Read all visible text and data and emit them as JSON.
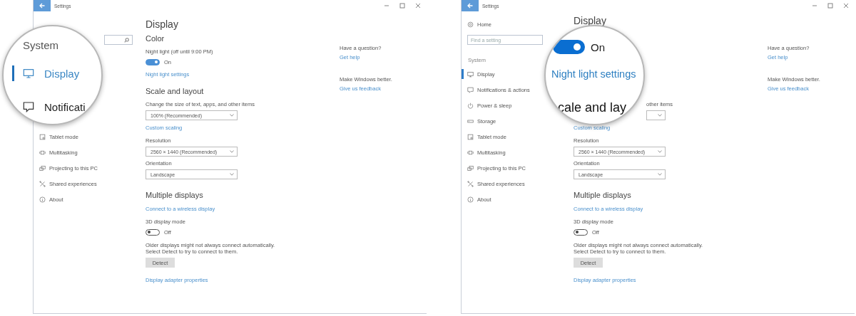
{
  "windows": [
    {
      "title": "Settings",
      "magnifier": {
        "kind": "sidebar",
        "blocks": [
          {
            "kind": "heading",
            "text": "System"
          },
          {
            "kind": "display",
            "text": "Display",
            "selected": true
          },
          {
            "kind": "notifications",
            "text": "Notificati",
            "selected": false
          }
        ]
      },
      "sidebar": {
        "search_icon": true,
        "items": [
          {
            "kind": "tablet",
            "label": "Tablet mode",
            "selected": false
          },
          {
            "kind": "multitasking",
            "label": "Multitasking",
            "selected": false
          },
          {
            "kind": "projecting",
            "label": "Projecting to this PC",
            "selected": false
          },
          {
            "kind": "shared",
            "label": "Shared experiences",
            "selected": false
          },
          {
            "kind": "about",
            "label": "About",
            "selected": false
          }
        ]
      },
      "content": [
        {
          "kind": "heading",
          "text": "Display"
        },
        {
          "kind": "section",
          "text": "Color"
        },
        {
          "kind": "label",
          "text": "Night light (off until 9:00 PM)"
        },
        {
          "kind": "toggle",
          "on": true,
          "text": "On"
        },
        {
          "kind": "link",
          "text": "Night light settings"
        },
        {
          "kind": "section",
          "text": "Scale and layout"
        },
        {
          "kind": "label",
          "text": "Change the size of text, apps, and other items"
        },
        {
          "kind": "dropdown",
          "value": "100% (Recommended)"
        },
        {
          "kind": "link",
          "text": "Custom scaling"
        },
        {
          "kind": "label",
          "text": "Resolution"
        },
        {
          "kind": "dropdown",
          "value": "2560 × 1440 (Recommended)"
        },
        {
          "kind": "label",
          "text": "Orientation"
        },
        {
          "kind": "dropdown",
          "value": "Landscape"
        },
        {
          "kind": "section",
          "text": "Multiple displays"
        },
        {
          "kind": "link",
          "text": "Connect to a wireless display"
        },
        {
          "kind": "label",
          "text": "3D display mode"
        },
        {
          "kind": "toggle",
          "on": false,
          "text": "Off"
        },
        {
          "kind": "text",
          "text": "Older displays might not always connect automatically. Select Detect to try to connect to them."
        },
        {
          "kind": "button",
          "text": "Detect"
        },
        {
          "kind": "link",
          "text": "Display adapter properties"
        }
      ],
      "aside": [
        {
          "kind": "text",
          "text": "Have a question?"
        },
        {
          "kind": "link",
          "text": "Get help"
        },
        {
          "kind": "text",
          "text": "Make Windows better."
        },
        {
          "kind": "link",
          "text": "Give us feedback"
        }
      ]
    },
    {
      "title": "Settings",
      "magnifier": {
        "kind": "content",
        "blocks": [
          {
            "kind": "toggle",
            "on": true,
            "text": "On"
          },
          {
            "kind": "link",
            "text": "Night light settings"
          },
          {
            "kind": "heading",
            "text": "cale and lay"
          }
        ]
      },
      "sidebar": {
        "home": "Home",
        "search_placeholder": "Find a setting",
        "section": "System",
        "items": [
          {
            "kind": "display",
            "label": "Display",
            "selected": true
          },
          {
            "kind": "notifications",
            "label": "Notifications & actions",
            "selected": false
          },
          {
            "kind": "power",
            "label": "Power & sleep",
            "selected": false
          },
          {
            "kind": "storage",
            "label": "Storage",
            "selected": false
          },
          {
            "kind": "tablet",
            "label": "Tablet mode",
            "selected": false
          },
          {
            "kind": "multitasking",
            "label": "Multitasking",
            "selected": false
          },
          {
            "kind": "projecting",
            "label": "Projecting to this PC",
            "selected": false
          },
          {
            "kind": "shared",
            "label": "Shared experiences",
            "selected": false
          },
          {
            "kind": "about",
            "label": "About",
            "selected": false
          }
        ]
      },
      "content": [
        {
          "kind": "heading",
          "text": "Display"
        },
        {
          "kind": "tail",
          "text": "other items"
        },
        {
          "kind": "dropdown"
        },
        {
          "kind": "link",
          "text": "Custom scaling"
        },
        {
          "kind": "label",
          "text": "Resolution"
        },
        {
          "kind": "dropdown",
          "value": "2560 × 1440 (Recommended)"
        },
        {
          "kind": "label",
          "text": "Orientation"
        },
        {
          "kind": "dropdown",
          "value": "Landscape"
        },
        {
          "kind": "section",
          "text": "Multiple displays"
        },
        {
          "kind": "link",
          "text": "Connect to a wireless display"
        },
        {
          "kind": "label",
          "text": "3D display mode"
        },
        {
          "kind": "toggle",
          "on": false,
          "text": "Off"
        },
        {
          "kind": "text",
          "text": "Older displays might not always connect automatically. Select Detect to try to connect to them."
        },
        {
          "kind": "button",
          "text": "Detect"
        },
        {
          "kind": "link",
          "text": "Display adapter properties"
        }
      ],
      "aside": [
        {
          "kind": "text",
          "text": "Have a question?"
        },
        {
          "kind": "link",
          "text": "Get help"
        },
        {
          "kind": "text",
          "text": "Make Windows better."
        },
        {
          "kind": "link",
          "text": "Give us feedback"
        }
      ]
    }
  ]
}
